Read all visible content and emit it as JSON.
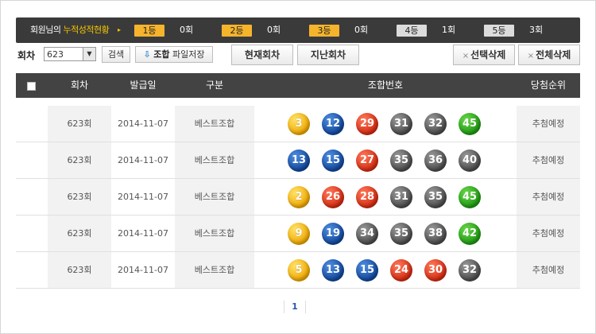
{
  "stats": {
    "title_prefix": "회원님의 ",
    "title_highlight": "누적성적현황",
    "arrow": "▸",
    "ranks": [
      {
        "label": "1등",
        "count": "0회"
      },
      {
        "label": "2등",
        "count": "0회"
      },
      {
        "label": "3등",
        "count": "0회"
      },
      {
        "label": "4등",
        "count": "1회"
      },
      {
        "label": "5등",
        "count": "3회"
      }
    ]
  },
  "toolbar": {
    "round_label": "회차",
    "round_value": "623",
    "search_label": "검색",
    "save_icon": "⇩",
    "save_bold": "조합",
    "save_label": " 파일저장",
    "current_label": "현재회차",
    "previous_label": "지난회차",
    "x_glyph": "×",
    "select_delete_label": "선택삭제",
    "all_delete_label": "전체삭제"
  },
  "table": {
    "headers": {
      "round": "회차",
      "date": "발급일",
      "type": "구분",
      "numbers": "조합번호",
      "result": "당첨순위"
    },
    "rows": [
      {
        "round": "623회",
        "date": "2014-11-07",
        "type": "베스트조합",
        "result": "추첨예정",
        "balls": [
          {
            "n": "3",
            "c": "yellow"
          },
          {
            "n": "12",
            "c": "blue"
          },
          {
            "n": "29",
            "c": "red"
          },
          {
            "n": "31",
            "c": "gray"
          },
          {
            "n": "32",
            "c": "gray"
          },
          {
            "n": "45",
            "c": "green"
          }
        ]
      },
      {
        "round": "623회",
        "date": "2014-11-07",
        "type": "베스트조합",
        "result": "추첨예정",
        "balls": [
          {
            "n": "13",
            "c": "blue"
          },
          {
            "n": "15",
            "c": "blue"
          },
          {
            "n": "27",
            "c": "red"
          },
          {
            "n": "35",
            "c": "gray"
          },
          {
            "n": "36",
            "c": "gray"
          },
          {
            "n": "40",
            "c": "gray"
          }
        ]
      },
      {
        "round": "623회",
        "date": "2014-11-07",
        "type": "베스트조합",
        "result": "추첨예정",
        "balls": [
          {
            "n": "2",
            "c": "yellow"
          },
          {
            "n": "26",
            "c": "red"
          },
          {
            "n": "28",
            "c": "red"
          },
          {
            "n": "31",
            "c": "gray"
          },
          {
            "n": "35",
            "c": "gray"
          },
          {
            "n": "45",
            "c": "green"
          }
        ]
      },
      {
        "round": "623회",
        "date": "2014-11-07",
        "type": "베스트조합",
        "result": "추첨예정",
        "balls": [
          {
            "n": "9",
            "c": "yellow"
          },
          {
            "n": "19",
            "c": "blue"
          },
          {
            "n": "34",
            "c": "gray"
          },
          {
            "n": "35",
            "c": "gray"
          },
          {
            "n": "38",
            "c": "gray"
          },
          {
            "n": "42",
            "c": "green"
          }
        ]
      },
      {
        "round": "623회",
        "date": "2014-11-07",
        "type": "베스트조합",
        "result": "추첨예정",
        "balls": [
          {
            "n": "5",
            "c": "yellow"
          },
          {
            "n": "13",
            "c": "blue"
          },
          {
            "n": "15",
            "c": "blue"
          },
          {
            "n": "24",
            "c": "red"
          },
          {
            "n": "30",
            "c": "red"
          },
          {
            "n": "32",
            "c": "gray"
          }
        ]
      }
    ]
  },
  "pager": {
    "current": "1"
  }
}
